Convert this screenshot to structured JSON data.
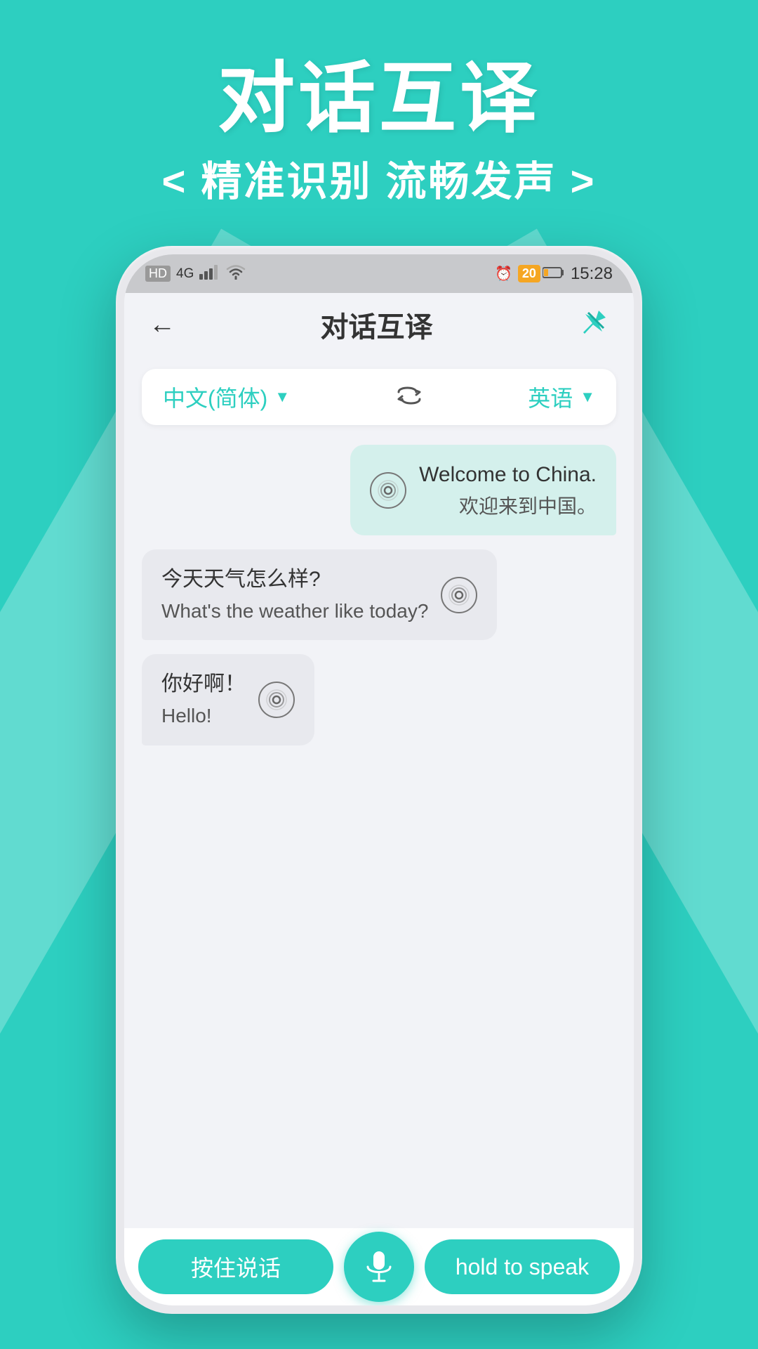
{
  "background": {
    "color": "#2DCFC0"
  },
  "header": {
    "title": "对话互译",
    "subtitle": "< 精准识别   流畅发声 >"
  },
  "status_bar": {
    "left": {
      "hd": "HD",
      "signal_4g": "4G",
      "wifi": "WiFi"
    },
    "right": {
      "alarm": "⏰",
      "battery": "20",
      "time": "15:28"
    }
  },
  "app_header": {
    "back_label": "←",
    "title": "对话互译",
    "pin_label": "📌"
  },
  "language_selector": {
    "left_lang": "中文(简体)",
    "left_arrow": "▼",
    "right_lang": "英语",
    "right_arrow": "▼"
  },
  "messages": [
    {
      "id": 1,
      "side": "right",
      "primary": "Welcome to China.",
      "secondary": "欢迎来到中国。"
    },
    {
      "id": 2,
      "side": "left",
      "primary": "今天天气怎么样?",
      "secondary": "What's the weather like today?"
    },
    {
      "id": 3,
      "side": "left",
      "primary": "你好啊！",
      "secondary": "Hello!"
    }
  ],
  "bottom_bar": {
    "left_btn": "按住说话",
    "right_btn": "hold to speak"
  }
}
